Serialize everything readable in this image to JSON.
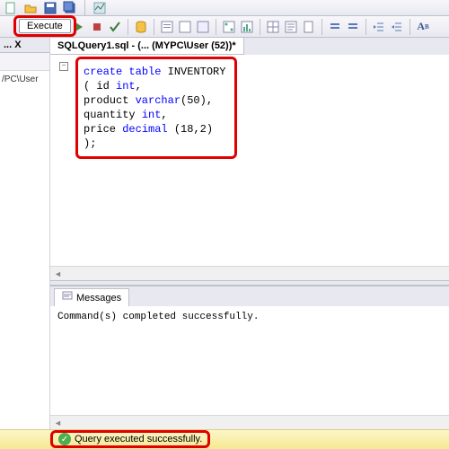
{
  "toolbar": {
    "execute_label": "Execute"
  },
  "left_panel": {
    "title": "... X",
    "tree_node": "/PC\\User"
  },
  "document": {
    "tab_title": "SQLQuery1.sql - (... (MYPC\\User (52))*"
  },
  "code": {
    "l1a": "create",
    "l1b": " table",
    "l1c": " INVENTORY",
    "l2a": "( id ",
    "l2b": "int",
    "l2c": ",",
    "l3a": "product ",
    "l3b": "varchar",
    "l3c": "(50),",
    "l4a": "quantity ",
    "l4b": "int",
    "l4c": ",",
    "l5a": "price ",
    "l5b": "decimal",
    "l5c": " (18,2)",
    "l6": ");"
  },
  "results": {
    "tab_label": "Messages",
    "message": "Command(s) completed successfully."
  },
  "status": {
    "text": "Query executed successfully."
  }
}
